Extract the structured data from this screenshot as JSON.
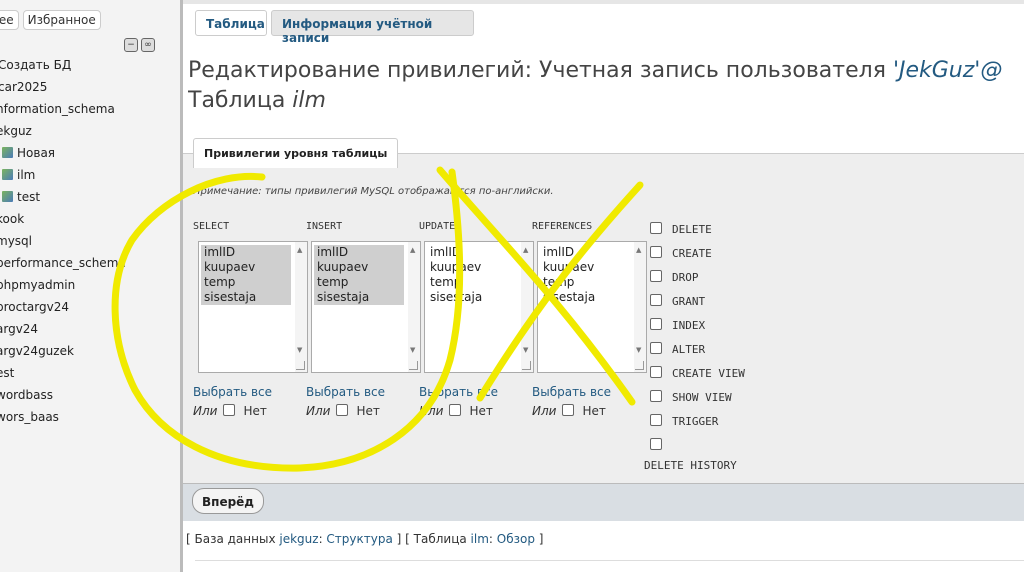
{
  "nav": {
    "tabs": [
      "нее",
      "Избранное"
    ],
    "items": [
      {
        "label": "Создать БД",
        "icon": false
      },
      {
        "label": "car2025",
        "icon": false
      },
      {
        "label": "nformation_schema",
        "icon": false
      },
      {
        "label": "ekguz",
        "icon": false
      },
      {
        "label": "Новая",
        "icon": true
      },
      {
        "label": "ilm",
        "icon": true
      },
      {
        "label": "test",
        "icon": true
      },
      {
        "label": "kook",
        "icon": false
      },
      {
        "label": "mysql",
        "icon": false
      },
      {
        "label": "performance_schema",
        "icon": false
      },
      {
        "label": "phpmyadmin",
        "icon": false
      },
      {
        "label": "proctargv24",
        "icon": false
      },
      {
        "label": "argv24",
        "icon": false
      },
      {
        "label": "argv24guzek",
        "icon": false
      },
      {
        "label": "est",
        "icon": false
      },
      {
        "label": "wordbass",
        "icon": false
      },
      {
        "label": "wors_baas",
        "icon": false
      }
    ]
  },
  "tabs": {
    "table": "Таблица",
    "account": "Информация учётной записи"
  },
  "title": {
    "prefix": "Редактирование привилегий: Учетная запись пользователя ",
    "user": "'JekGuz'@",
    "line2_prefix": "Таблица ",
    "line2_table": "ilm"
  },
  "fieldset": {
    "legend": "Привилегии уровня таблицы",
    "note": "Примечание: типы привилегий MySQL отображаются по-английски.",
    "columns": [
      {
        "header": "SELECT",
        "selected": true
      },
      {
        "header": "INSERT",
        "selected": true
      },
      {
        "header": "UPDATE",
        "selected": false
      },
      {
        "header": "REFERENCES",
        "selected": false
      }
    ],
    "fields": [
      "imlID",
      "kuupaev",
      "temp",
      "sisestaja"
    ],
    "select_all": "Выбрать все",
    "or": "Или",
    "none": "Нет",
    "privileges": [
      "DELETE",
      "CREATE",
      "DROP",
      "GRANT",
      "INDEX",
      "ALTER",
      "CREATE VIEW",
      "SHOW VIEW",
      "TRIGGER",
      "",
      "DELETE HISTORY"
    ]
  },
  "submit": "Вперёд",
  "breadcrumb": {
    "open": "[ База данных ",
    "db": "jekguz",
    "sep1": ": ",
    "struct": "Структура",
    "mid": " ] [ Таблица ",
    "table": "ilm",
    "sep2": ": ",
    "browse": "Обзор",
    "close": " ]"
  },
  "annotation": {
    "color": "#f0ea00"
  }
}
